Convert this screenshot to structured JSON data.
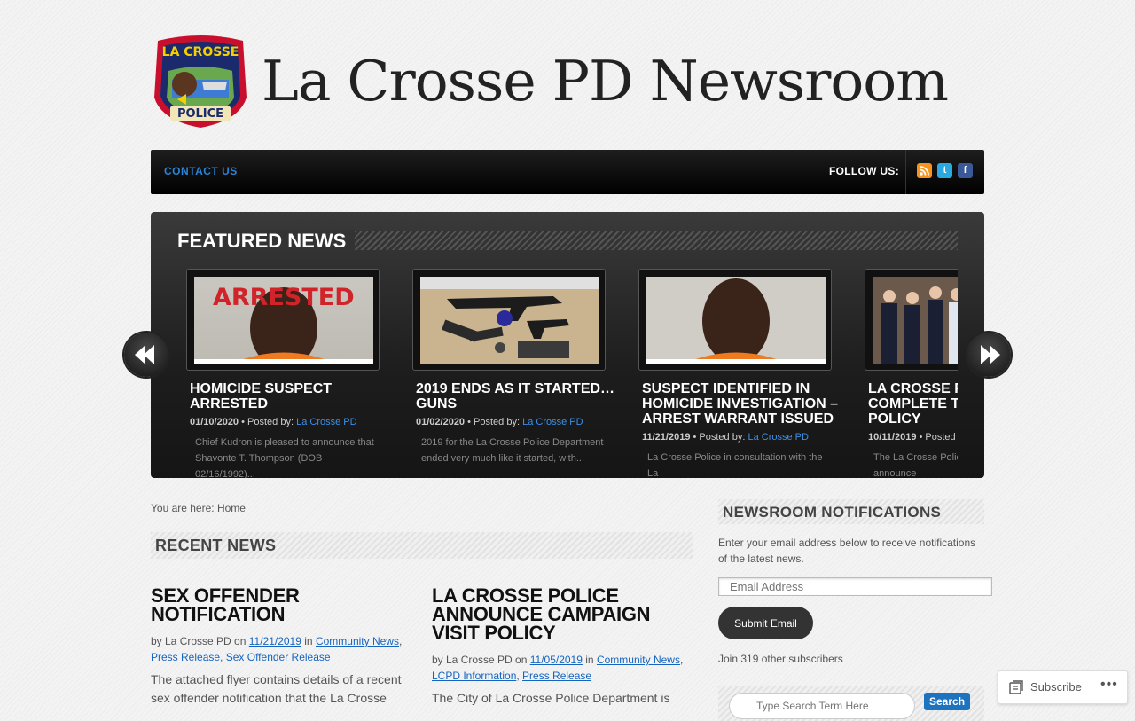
{
  "site": {
    "title": "La Crosse PD Newsroom",
    "logo_text_top": "LA CROSSE",
    "logo_text_bottom": "POLICE"
  },
  "nav": {
    "contact": "CONTACT US",
    "follow": "FOLLOW US:",
    "icons": [
      "rss-icon",
      "twitter-icon",
      "facebook-icon"
    ]
  },
  "featured": {
    "title": "FEATURED NEWS",
    "slides": [
      {
        "title": "HOMICIDE SUSPECT ARRESTED",
        "date": "01/10/2020",
        "posted_by": "• Posted by:",
        "author": "La Crosse PD",
        "excerpt": "Chief Kudron is pleased to announce that Shavonte T. Thompson (DOB 02/16/1992)...",
        "image_caption": "ARRESTED"
      },
      {
        "title": "2019 ENDS AS IT STARTED…GUNS",
        "date": "01/02/2020",
        "posted_by": "• Posted by:",
        "author": "La Crosse PD",
        "excerpt": "2019 for the La Crosse Police Department ended very much like it started, with..."
      },
      {
        "title": "SUSPECT IDENTIFIED IN HOMICIDE INVESTIGATION – ARREST WARRANT ISSUED",
        "date": "11/21/2019",
        "posted_by": "• Posted by:",
        "author": "La Crosse PD",
        "excerpt": "La Crosse Police in consultation with the La"
      },
      {
        "title": "LA CROSSE POLICE COMPLETE THE CAMPAIGN POLICY",
        "date": "10/11/2019",
        "posted_by": "• Posted",
        "author": "",
        "excerpt": "The La Crosse Police are pleased to announce"
      }
    ]
  },
  "breadcrumb": "You are here: Home",
  "recent": {
    "heading": "RECENT NEWS",
    "posts": [
      {
        "title": "SEX OFFENDER NOTIFICATION",
        "by": "by La Crosse PD on",
        "date": "11/21/2019",
        "in": "in",
        "cat1": "Community News",
        "cat2": "Press Release",
        "cat3": "Sex Offender Release",
        "excerpt": "The attached flyer contains details of a recent sex offender notification that the La Crosse"
      },
      {
        "title": "LA CROSSE POLICE ANNOUNCE CAMPAIGN VISIT POLICY",
        "by": "by La Crosse PD on",
        "date": "11/05/2019",
        "in": "in",
        "cat1": "Community News",
        "cat2": "LCPD Information",
        "cat3": "Press Release",
        "excerpt": "The City of La Crosse Police Department is"
      }
    ]
  },
  "sidebar": {
    "heading": "NEWSROOM NOTIFICATIONS",
    "text": "Enter your email address below to receive notifications of the latest news.",
    "email_placeholder": "Email Address",
    "submit": "Submit Email",
    "join": "Join 319 other subscribers",
    "search_placeholder": "Type Search Term Here",
    "search_button": "Search"
  },
  "subscribe": {
    "label": "Subscribe",
    "more": "•••"
  },
  "colors": {
    "link": "#1565c0",
    "nav_link": "#2d83d6",
    "featured_link": "#3d8fe6",
    "rss": "#f7941d",
    "twitter": "#2aa9e0",
    "facebook": "#3b5998"
  }
}
